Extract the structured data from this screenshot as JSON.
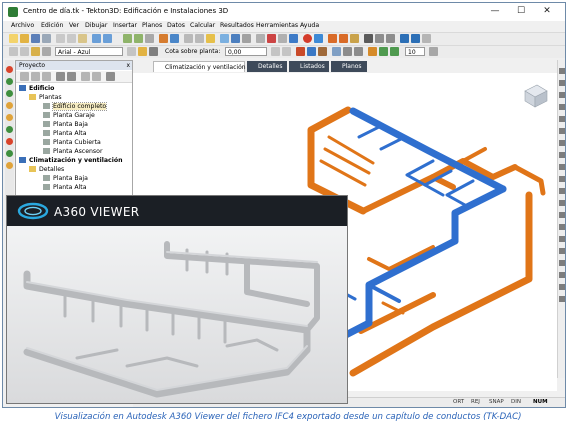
{
  "window": {
    "title": "Centro de día.tk - Tekton3D: Edificación e Instalaciones 3D",
    "buttons": [
      "—",
      "☐",
      "✕"
    ]
  },
  "menu": [
    "Archivo",
    "Edición",
    "Ver",
    "Dibujar",
    "Insertar",
    "Planos",
    "Datos",
    "Calcular",
    "Resultados",
    "Herramientas",
    "Ayuda"
  ],
  "toolbar2": {
    "font_combo": "Arial - Azul",
    "cota_label": "Cota sobre planta:",
    "cota_value": "0,00",
    "zoom_value": "10"
  },
  "panel": {
    "title": "Proyecto",
    "close": "x",
    "tree": [
      {
        "label": "Edificio",
        "level": 0,
        "bold": true,
        "icon": "building-icon"
      },
      {
        "label": "Plantas",
        "level": 1,
        "bold": false,
        "icon": "folder-icon"
      },
      {
        "label": "Edificio completo",
        "level": 2,
        "bold": false,
        "icon": "floor-icon",
        "selected": true
      },
      {
        "label": "Planta Garaje",
        "level": 2,
        "bold": false,
        "icon": "floor-icon"
      },
      {
        "label": "Planta Baja",
        "level": 2,
        "bold": false,
        "icon": "floor-icon"
      },
      {
        "label": "Planta Alta",
        "level": 2,
        "bold": false,
        "icon": "floor-icon"
      },
      {
        "label": "Planta Cubierta",
        "level": 2,
        "bold": false,
        "icon": "floor-icon"
      },
      {
        "label": "Planta Ascensor",
        "level": 2,
        "bold": false,
        "icon": "floor-icon"
      },
      {
        "label": "Climatización y ventilación",
        "level": 0,
        "bold": true,
        "icon": "hvac-icon"
      },
      {
        "label": "Detalles",
        "level": 1,
        "bold": false,
        "icon": "folder-icon"
      },
      {
        "label": "Planta Baja",
        "level": 2,
        "bold": false,
        "icon": "floor-icon"
      },
      {
        "label": "Planta Alta",
        "level": 2,
        "bold": false,
        "icon": "floor-icon"
      }
    ]
  },
  "tabs": [
    {
      "label": "Climatización y ventilación",
      "active": true
    },
    {
      "label": "Detalles",
      "active": false
    },
    {
      "label": "Listados",
      "active": false
    },
    {
      "label": "Planos",
      "active": false
    }
  ],
  "status": [
    "ORT",
    "REJ",
    "SNAP",
    "DIN",
    "NUM"
  ],
  "a360": {
    "brand": "A360 VIEWER"
  },
  "caption": "Visualización en Autodesk A360 Viewer del fichero IFC4 exportado desde un capítulo de conductos (TK-DAC)",
  "colors": {
    "duct_orange": "#e07518",
    "duct_blue": "#2f6fcf",
    "caption_blue": "#2a63b8",
    "a360_header": "#1b1f25"
  }
}
